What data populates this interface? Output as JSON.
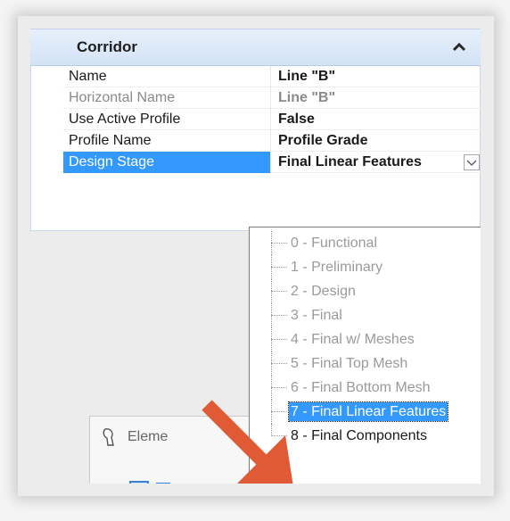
{
  "section": {
    "title": "Corridor",
    "collapse_icon": "chevron-up-icon"
  },
  "properties": [
    {
      "label": "Name",
      "value": "Line \"B\"",
      "disabled": false,
      "selected": false
    },
    {
      "label": "Horizontal Name",
      "value": "Line \"B\"",
      "disabled": true,
      "selected": false
    },
    {
      "label": "Use Active Profile",
      "value": "False",
      "disabled": false,
      "selected": false
    },
    {
      "label": "Profile Name",
      "value": "Profile Grade",
      "disabled": false,
      "selected": false
    },
    {
      "label": "Design Stage",
      "value": "Final Linear Features",
      "disabled": false,
      "selected": true
    }
  ],
  "dropdown": {
    "options": [
      {
        "label": "0 - Functional",
        "state": "disabled"
      },
      {
        "label": "1 - Preliminary",
        "state": "disabled"
      },
      {
        "label": "2 - Design",
        "state": "disabled"
      },
      {
        "label": "3 - Final",
        "state": "disabled"
      },
      {
        "label": "4 - Final w/ Meshes",
        "state": "disabled"
      },
      {
        "label": "5 - Final Top Mesh",
        "state": "disabled"
      },
      {
        "label": "6 - Final Bottom Mesh",
        "state": "disabled"
      },
      {
        "label": "7 - Final Linear Features",
        "state": "selected"
      },
      {
        "label": "8 - Final Components",
        "state": "enabled"
      }
    ]
  },
  "element_window": {
    "title": "Eleme",
    "icon": "element-info-icon"
  },
  "colors": {
    "selection": "#3399ff",
    "header_gradient_top": "#e7f0fb",
    "pointer_arrow": "#e05a35"
  }
}
